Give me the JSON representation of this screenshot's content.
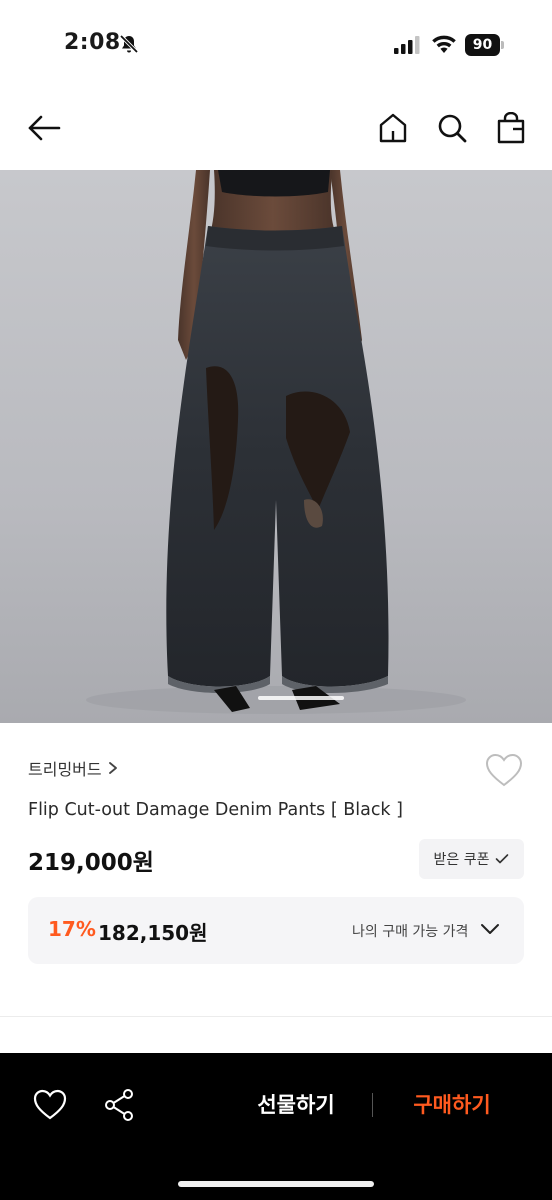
{
  "status_bar": {
    "time": "2:08",
    "battery": "90"
  },
  "product": {
    "brand": "트리밍버드",
    "name": "Flip Cut-out Damage Denim Pants [ Black ]",
    "price": "219,000원",
    "coupon_label": "받은 쿠폰",
    "discount_rate": "17%",
    "discount_price": "182,150원",
    "benefit_label": "나의 구매 가능 가격"
  },
  "bottom_bar": {
    "gift_label": "선물하기",
    "buy_label": "구매하기"
  },
  "colors": {
    "accent": "#ff5a1f",
    "bottom_bar_bg": "#000000"
  },
  "icons": {
    "back": "arrow-left-icon",
    "home": "home-icon",
    "search": "search-icon",
    "bag": "shopping-bag-icon",
    "wish": "heart-icon",
    "share": "share-icon"
  }
}
